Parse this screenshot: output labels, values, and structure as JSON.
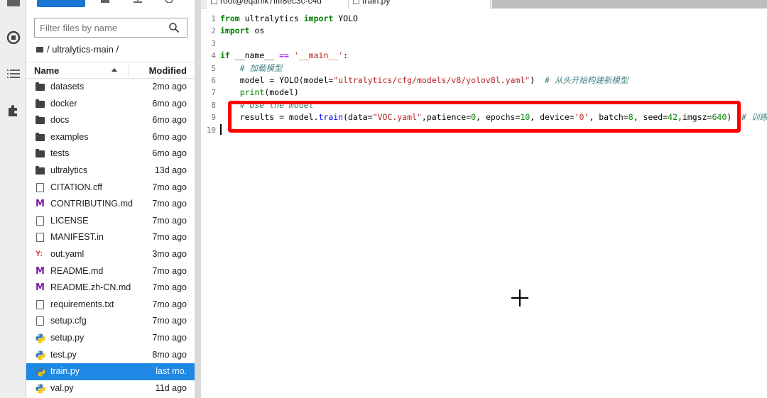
{
  "search": {
    "placeholder": "Filter files by name"
  },
  "breadcrumb": {
    "path": "/ ultralytics-main /"
  },
  "columns": {
    "name": "Name",
    "modified": "Modified"
  },
  "files": [
    {
      "type": "folder",
      "name": "datasets",
      "modified": "2mo ago"
    },
    {
      "type": "folder",
      "name": "docker",
      "modified": "6mo ago"
    },
    {
      "type": "folder",
      "name": "docs",
      "modified": "6mo ago"
    },
    {
      "type": "folder",
      "name": "examples",
      "modified": "6mo ago"
    },
    {
      "type": "folder",
      "name": "tests",
      "modified": "6mo ago"
    },
    {
      "type": "folder",
      "name": "ultralytics",
      "modified": "13d ago"
    },
    {
      "type": "file",
      "name": "CITATION.cff",
      "modified": "7mo ago"
    },
    {
      "type": "markdown",
      "name": "CONTRIBUTING.md",
      "modified": "7mo ago"
    },
    {
      "type": "file",
      "name": "LICENSE",
      "modified": "7mo ago"
    },
    {
      "type": "file",
      "name": "MANIFEST.in",
      "modified": "7mo ago"
    },
    {
      "type": "yaml",
      "name": "out.yaml",
      "modified": "3mo ago"
    },
    {
      "type": "markdown",
      "name": "README.md",
      "modified": "7mo ago"
    },
    {
      "type": "markdown",
      "name": "README.zh-CN.md",
      "modified": "7mo ago"
    },
    {
      "type": "file",
      "name": "requirements.txt",
      "modified": "7mo ago"
    },
    {
      "type": "file",
      "name": "setup.cfg",
      "modified": "7mo ago"
    },
    {
      "type": "python",
      "name": "setup.py",
      "modified": "7mo ago"
    },
    {
      "type": "python",
      "name": "test.py",
      "modified": "8mo ago"
    },
    {
      "type": "python",
      "name": "train.py",
      "modified": "last mo.",
      "selected": true
    },
    {
      "type": "python",
      "name": "val.py",
      "modified": "11d ago"
    }
  ],
  "tabs": [
    {
      "label": "root@eqanik7ffff8ec3c-c4d"
    },
    {
      "label": "train.py"
    }
  ],
  "line_numbers": [
    "1",
    "2",
    "3",
    "4",
    "5",
    "6",
    "7",
    "8",
    "9",
    "10"
  ],
  "code": {
    "l1_a": "from",
    "l1_b": " ultralytics ",
    "l1_c": "import",
    "l1_d": " YOLO",
    "l2_a": "import",
    "l2_b": " os",
    "l4_a": "if",
    "l4_b": " __name__ ",
    "l4_c": "==",
    "l4_d": " ",
    "l4_e": "'__main__'",
    "l4_f": ":",
    "l5": "    # 加载模型",
    "l6_a": "    model = YOLO(model=",
    "l6_b": "\"ultralytics/cfg/models/v8/yolov8l.yaml\"",
    "l6_c": ")  ",
    "l6_d": "# 从头开始构建新模型",
    "l7_a": "    ",
    "l7_b": "print",
    "l7_c": "(model)",
    "l8": "    # Use the model",
    "l9_a": "    results = model.",
    "l9_b": "train",
    "l9_c": "(data=",
    "l9_d": "\"VOC.yaml\"",
    "l9_e": ",patience=",
    "l9_f": "0",
    "l9_g": ", epochs=",
    "l9_h": "10",
    "l9_i": ", device=",
    "l9_j": "'0'",
    "l9_k": ", batch=",
    "l9_l": "8",
    "l9_m": ", seed=",
    "l9_n": "42",
    "l9_o": ",imgsz=",
    "l9_p": "640",
    "l9_q": ")  ",
    "l9_r": "# 训练模型"
  },
  "colors": {
    "accent": "#1976d2",
    "selected_row": "#1e88e5",
    "highlight_box": "#ff0000"
  },
  "icons": [
    "folder-icon",
    "file-icon",
    "markdown-icon",
    "yaml-icon",
    "python-icon",
    "search-icon",
    "stop-circle-icon",
    "list-icon",
    "puzzle-icon"
  ]
}
